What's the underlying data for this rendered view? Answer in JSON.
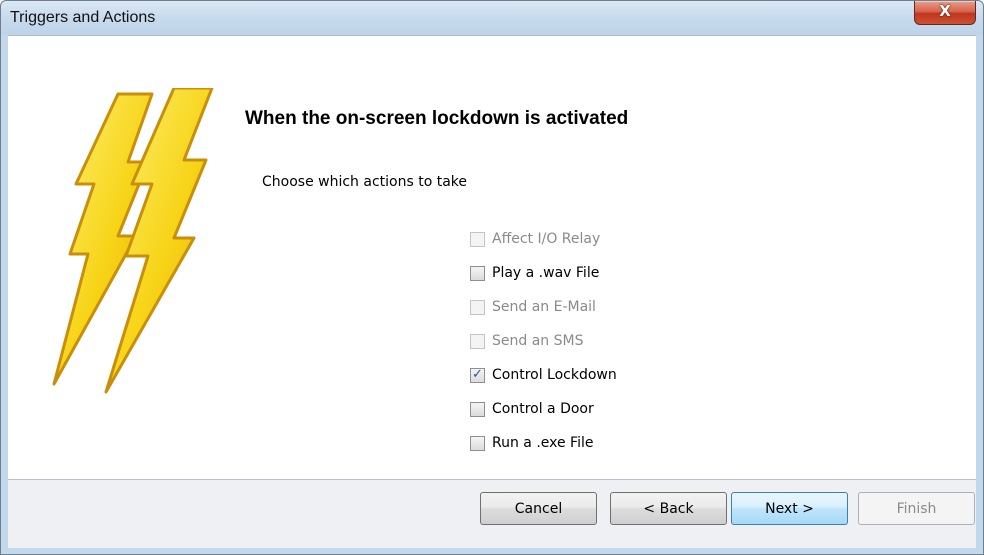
{
  "window": {
    "title": "Triggers and Actions",
    "close_glyph": "X"
  },
  "main": {
    "heading": "When the on-screen lockdown is activated",
    "subheading": "Choose which actions to take",
    "icon": "lightning-bolt-icon",
    "actions": [
      {
        "label": "Affect I/O Relay",
        "checked": false,
        "enabled": false
      },
      {
        "label": "Play a .wav File",
        "checked": false,
        "enabled": true
      },
      {
        "label": "Send an E-Mail",
        "checked": false,
        "enabled": false
      },
      {
        "label": "Send an SMS",
        "checked": false,
        "enabled": false
      },
      {
        "label": "Control Lockdown",
        "checked": true,
        "enabled": true
      },
      {
        "label": "Control a Door",
        "checked": false,
        "enabled": true
      },
      {
        "label": "Run a .exe File",
        "checked": false,
        "enabled": true
      }
    ]
  },
  "footer": {
    "cancel_label": "Cancel",
    "back_label": "< Back",
    "next_label": "Next >",
    "finish_label": "Finish"
  },
  "colors": {
    "frame": "#c3d8ea",
    "close_button": "#c8442a",
    "check": "#2b4fa8",
    "bolt_fill": "#f7d417",
    "bolt_edge": "#c98e0a"
  }
}
